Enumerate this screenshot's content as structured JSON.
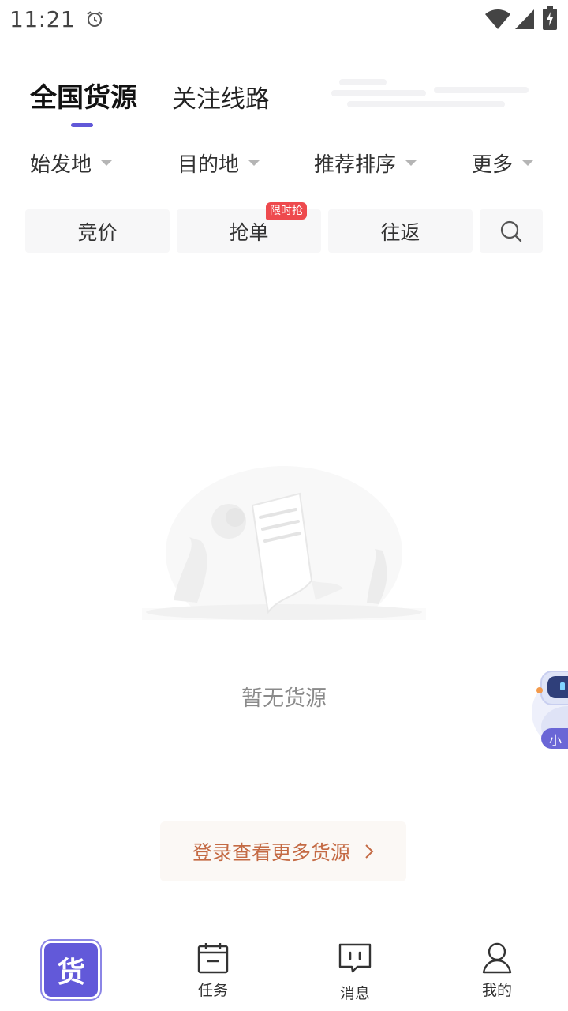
{
  "status_bar": {
    "time": "11:21"
  },
  "header": {
    "tabs": [
      {
        "label": "全国货源",
        "active": true
      },
      {
        "label": "关注线路",
        "active": false
      }
    ],
    "accent_color": "#6158d8"
  },
  "filters": [
    {
      "label": "始发地"
    },
    {
      "label": "目的地"
    },
    {
      "label": "推荐排序"
    },
    {
      "label": "更多"
    }
  ],
  "quick_buttons": [
    {
      "label": "竞价"
    },
    {
      "label": "抢单",
      "badge": "限时抢"
    },
    {
      "label": "往返"
    }
  ],
  "empty_state": {
    "text": "暂无货源"
  },
  "assistant": {
    "label": "小"
  },
  "login_cta": {
    "label": "登录查看更多货源"
  },
  "bottom_nav": [
    {
      "label": "货",
      "icon": "cargo-icon",
      "active": true
    },
    {
      "label": "任务",
      "icon": "calendar-icon"
    },
    {
      "label": "消息",
      "icon": "message-icon"
    },
    {
      "label": "我的",
      "icon": "person-icon"
    }
  ]
}
